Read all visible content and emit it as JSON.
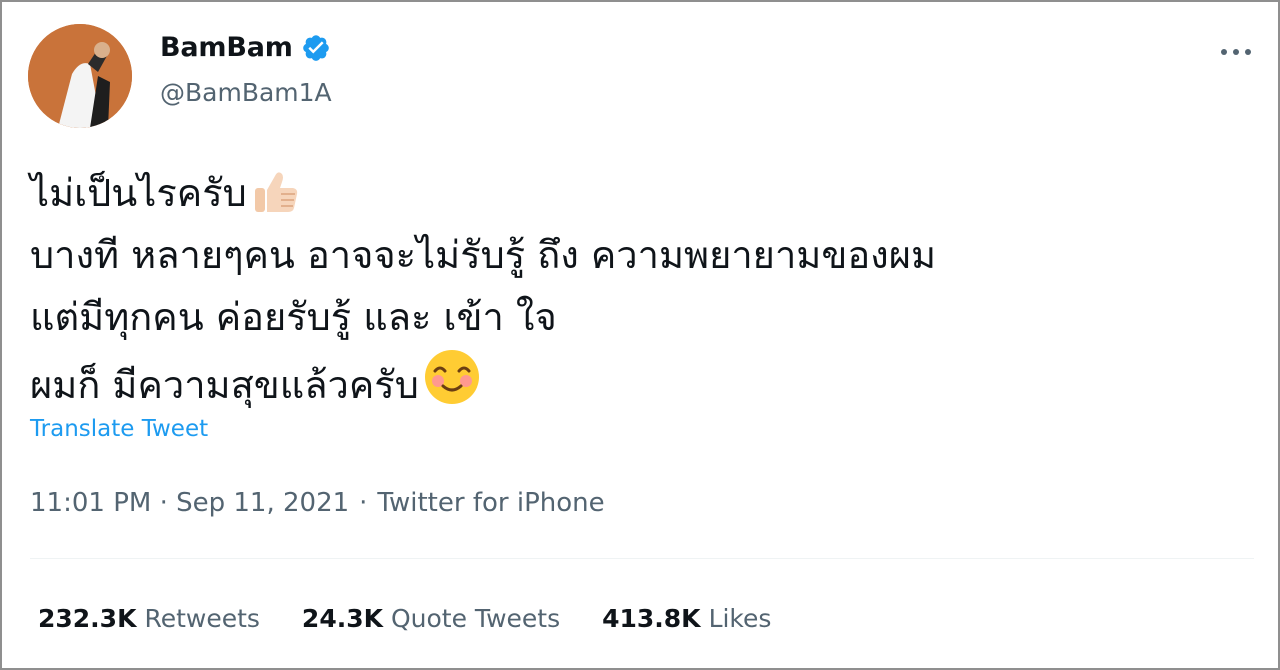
{
  "tweet": {
    "author": {
      "display_name": "BamBam",
      "handle": "@BamBam1A",
      "verified_icon": "verified-badge-icon",
      "avatar_bg": "#c9733a"
    },
    "more_icon": "more-options-icon",
    "text_lines": [
      "ไม่เป็นไรครับ",
      "บางที หลายๆคน อาจจะไม่รับรู้ ถึง ความพยายามของผม",
      "แต่มีทุกคน ค่อยรับรู้ และ เข้า ใจ",
      "ผมก็ มีความสุขแล้วครับ"
    ],
    "emojis": [
      "thumbs-up-emoji",
      "smiling-blush-emoji"
    ],
    "translate_label": "Translate Tweet",
    "timestamp": "11:01 PM · Sep 11, 2021",
    "separator": "·",
    "source": "Twitter for iPhone",
    "stats": {
      "retweets": {
        "count": "232.3K",
        "label": "Retweets"
      },
      "quotes": {
        "count": "24.3K",
        "label": "Quote Tweets"
      },
      "likes": {
        "count": "413.8K",
        "label": "Likes"
      }
    },
    "colors": {
      "link": "#1d9bf0",
      "secondary_text": "#536471",
      "primary_text": "#0f1419",
      "verified": "#1d9bf0"
    }
  }
}
